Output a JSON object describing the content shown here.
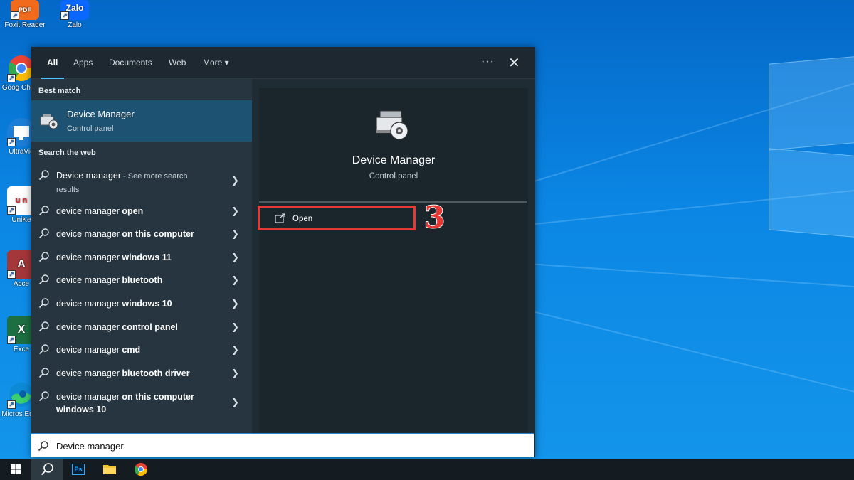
{
  "desktop": {
    "icons": [
      {
        "label": "Foxit Reader",
        "icon": "foxit-pdf-icon",
        "color": "#f26a1b",
        "glyph": "PDF"
      },
      {
        "label": "Zalo",
        "icon": "zalo-icon",
        "color": "#0a68ff",
        "glyph": "Zalo"
      },
      {
        "label": "Goog Chron",
        "icon": "chrome-icon",
        "color": "#34a853",
        "glyph": ""
      },
      {
        "label": "UltraVie",
        "icon": "ultraviewer-icon",
        "color": "#1c7ed6",
        "glyph": ""
      },
      {
        "label": "UniKe",
        "icon": "unikey-icon",
        "color": "#ffffff",
        "glyph": "u n"
      },
      {
        "label": "Acce",
        "icon": "access-icon",
        "color": "#a4373a",
        "glyph": "A"
      },
      {
        "label": "Exce",
        "icon": "excel-icon",
        "color": "#1d6f42",
        "glyph": "X"
      },
      {
        "label": "Micros Edge",
        "icon": "edge-icon",
        "color": "#0c8ad6",
        "glyph": ""
      }
    ]
  },
  "tabs": [
    {
      "label": "All",
      "active": true
    },
    {
      "label": "Apps",
      "active": false
    },
    {
      "label": "Documents",
      "active": false
    },
    {
      "label": "Web",
      "active": false
    },
    {
      "label": "More ▾",
      "active": false
    }
  ],
  "header": {
    "more_options": "···",
    "close": "✕"
  },
  "best_match": {
    "section_title": "Best match",
    "title": "Device Manager",
    "subtitle": "Control panel"
  },
  "web": {
    "section_title": "Search the web",
    "items": [
      {
        "prefix": "Device manager",
        "bold": "",
        "suffix": " - See more search",
        "sub": "results"
      },
      {
        "prefix": "device manager ",
        "bold": "open",
        "suffix": "",
        "sub": ""
      },
      {
        "prefix": "device manager ",
        "bold": "on this computer",
        "suffix": "",
        "sub": ""
      },
      {
        "prefix": "device manager ",
        "bold": "windows 11",
        "suffix": "",
        "sub": ""
      },
      {
        "prefix": "device manager ",
        "bold": "bluetooth",
        "suffix": "",
        "sub": ""
      },
      {
        "prefix": "device manager ",
        "bold": "windows 10",
        "suffix": "",
        "sub": ""
      },
      {
        "prefix": "device manager ",
        "bold": "control panel",
        "suffix": "",
        "sub": ""
      },
      {
        "prefix": "device manager ",
        "bold": "cmd",
        "suffix": "",
        "sub": ""
      },
      {
        "prefix": "device manager ",
        "bold": "bluetooth driver",
        "suffix": "",
        "sub": ""
      },
      {
        "prefix": "device manager ",
        "bold": "on this computer",
        "suffix": "",
        "sub": "windows 10"
      }
    ]
  },
  "preview": {
    "title": "Device Manager",
    "subtitle": "Control panel",
    "open_label": "Open",
    "step_number": "3"
  },
  "search": {
    "value": "Device manager"
  },
  "taskbar": {
    "items": [
      {
        "name": "start-button",
        "icon": "windows-logo-icon"
      },
      {
        "name": "search-button",
        "icon": "search-icon"
      },
      {
        "name": "photoshop-button",
        "icon": "photoshop-icon",
        "glyph": "Ps"
      },
      {
        "name": "file-explorer-button",
        "icon": "folder-icon"
      },
      {
        "name": "chrome-button",
        "icon": "chrome-icon"
      }
    ]
  },
  "colors": {
    "accent": "#4cc2ff",
    "highlight": "#e53935",
    "selected": "#1e5272"
  }
}
